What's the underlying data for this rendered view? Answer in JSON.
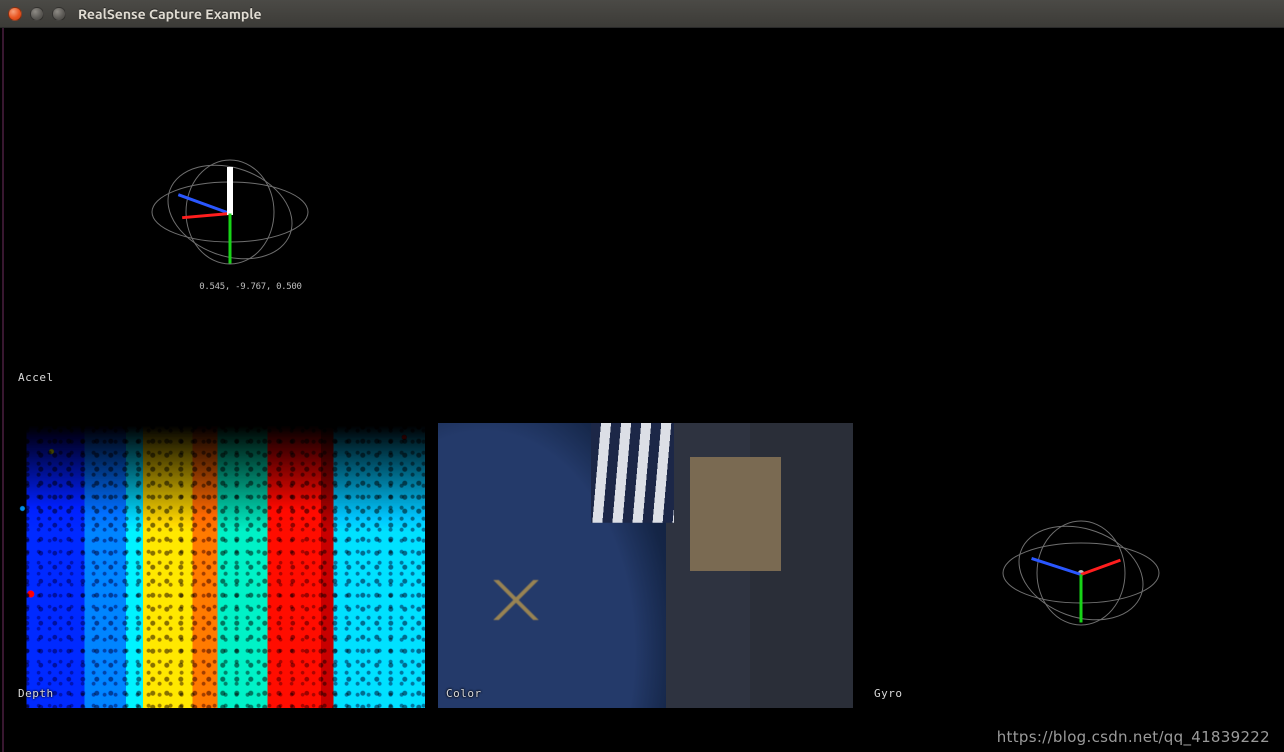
{
  "window": {
    "title": "RealSense Capture Example"
  },
  "streams": {
    "accel": {
      "label": "Accel",
      "readout": "0.545, -9.767, 0.500"
    },
    "depth": {
      "label": "Depth"
    },
    "color": {
      "label": "Color"
    },
    "gyro": {
      "label": "Gyro"
    }
  },
  "watermark": "https://blog.csdn.net/qq_41839222"
}
